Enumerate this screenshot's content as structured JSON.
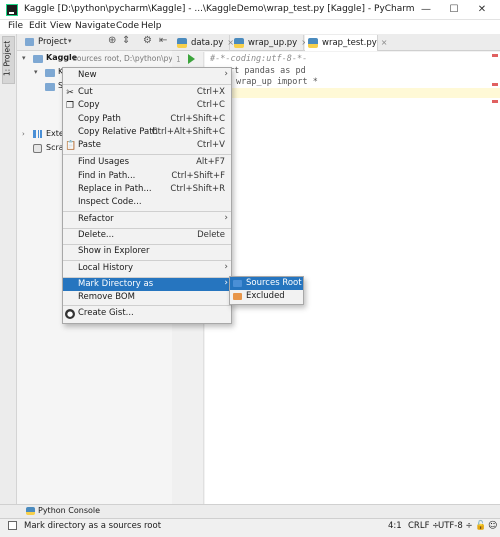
{
  "window": {
    "title": "Kaggle [D:\\python\\pycharm\\Kaggle] - ...\\KaggleDemo\\wrap_test.py [Kaggle] - PyCharm",
    "minimize": "—",
    "maximize": "☐",
    "close": "✕"
  },
  "menubar": [
    "File",
    "Edit",
    "View",
    "Navigate",
    "Code",
    "Help"
  ],
  "left_stripe": {
    "project_label": "1: Project"
  },
  "project_panel": {
    "view_selector": "Project",
    "root_name": "Kaggle",
    "root_note": "sources root,  D:\\python\\py",
    "child_initial": "K",
    "child2_initial": "S",
    "external_libs": "Exter",
    "scratches": "Scrat"
  },
  "tabs": [
    "data.py",
    "wrap_up.py",
    "wrap_test.py"
  ],
  "editor": {
    "line_numbers": [
      "1"
    ],
    "lines": [
      "#-*-coding:utf-8-*-",
      "rt pandas as pd",
      "wrap_up import *"
    ]
  },
  "context_menu": {
    "items": [
      {
        "label": "New",
        "shortcut": "",
        "submenu": true,
        "icon": ""
      },
      {
        "label": "Cut",
        "shortcut": "Ctrl+X",
        "submenu": false,
        "icon": "cut-icon"
      },
      {
        "label": "Copy",
        "shortcut": "Ctrl+C",
        "submenu": false,
        "icon": "copy-icon"
      },
      {
        "label": "Copy Path",
        "shortcut": "Ctrl+Shift+C",
        "submenu": false,
        "icon": ""
      },
      {
        "label": "Copy Relative Path",
        "shortcut": "Ctrl+Alt+Shift+C",
        "submenu": false,
        "icon": ""
      },
      {
        "label": "Paste",
        "shortcut": "Ctrl+V",
        "submenu": false,
        "icon": "paste-icon"
      },
      {
        "label": "Find Usages",
        "shortcut": "Alt+F7",
        "submenu": false,
        "icon": ""
      },
      {
        "label": "Find in Path...",
        "shortcut": "Ctrl+Shift+F",
        "submenu": false,
        "icon": ""
      },
      {
        "label": "Replace in Path...",
        "shortcut": "Ctrl+Shift+R",
        "submenu": false,
        "icon": ""
      },
      {
        "label": "Inspect Code...",
        "shortcut": "",
        "submenu": false,
        "icon": ""
      },
      {
        "label": "Refactor",
        "shortcut": "",
        "submenu": true,
        "icon": ""
      },
      {
        "label": "Delete...",
        "shortcut": "Delete",
        "submenu": false,
        "icon": ""
      },
      {
        "label": "Show in Explorer",
        "shortcut": "",
        "submenu": false,
        "icon": ""
      },
      {
        "label": "Local History",
        "shortcut": "",
        "submenu": true,
        "icon": ""
      },
      {
        "label": "Mark Directory as",
        "shortcut": "",
        "submenu": true,
        "icon": ""
      },
      {
        "label": "Remove BOM",
        "shortcut": "",
        "submenu": false,
        "icon": ""
      },
      {
        "label": "Create Gist...",
        "shortcut": "",
        "submenu": false,
        "icon": "github-icon"
      }
    ],
    "submenu_arrow": "›"
  },
  "submenu": {
    "items": [
      {
        "label": "Sources Root",
        "color": "#4a8fd6"
      },
      {
        "label": "Excluded",
        "color": "#e8964a"
      }
    ]
  },
  "bottom_bar": {
    "python_console": "Python Console"
  },
  "status_bar": {
    "message": "Mark directory as a sources root",
    "position": "4:1",
    "line_sep": "CRLF ÷",
    "encoding": "UTF-8 ÷"
  },
  "colors": {
    "selection": "#2675bf",
    "folder_blue": "#7ea8d3",
    "run_green": "#3ca43c"
  }
}
